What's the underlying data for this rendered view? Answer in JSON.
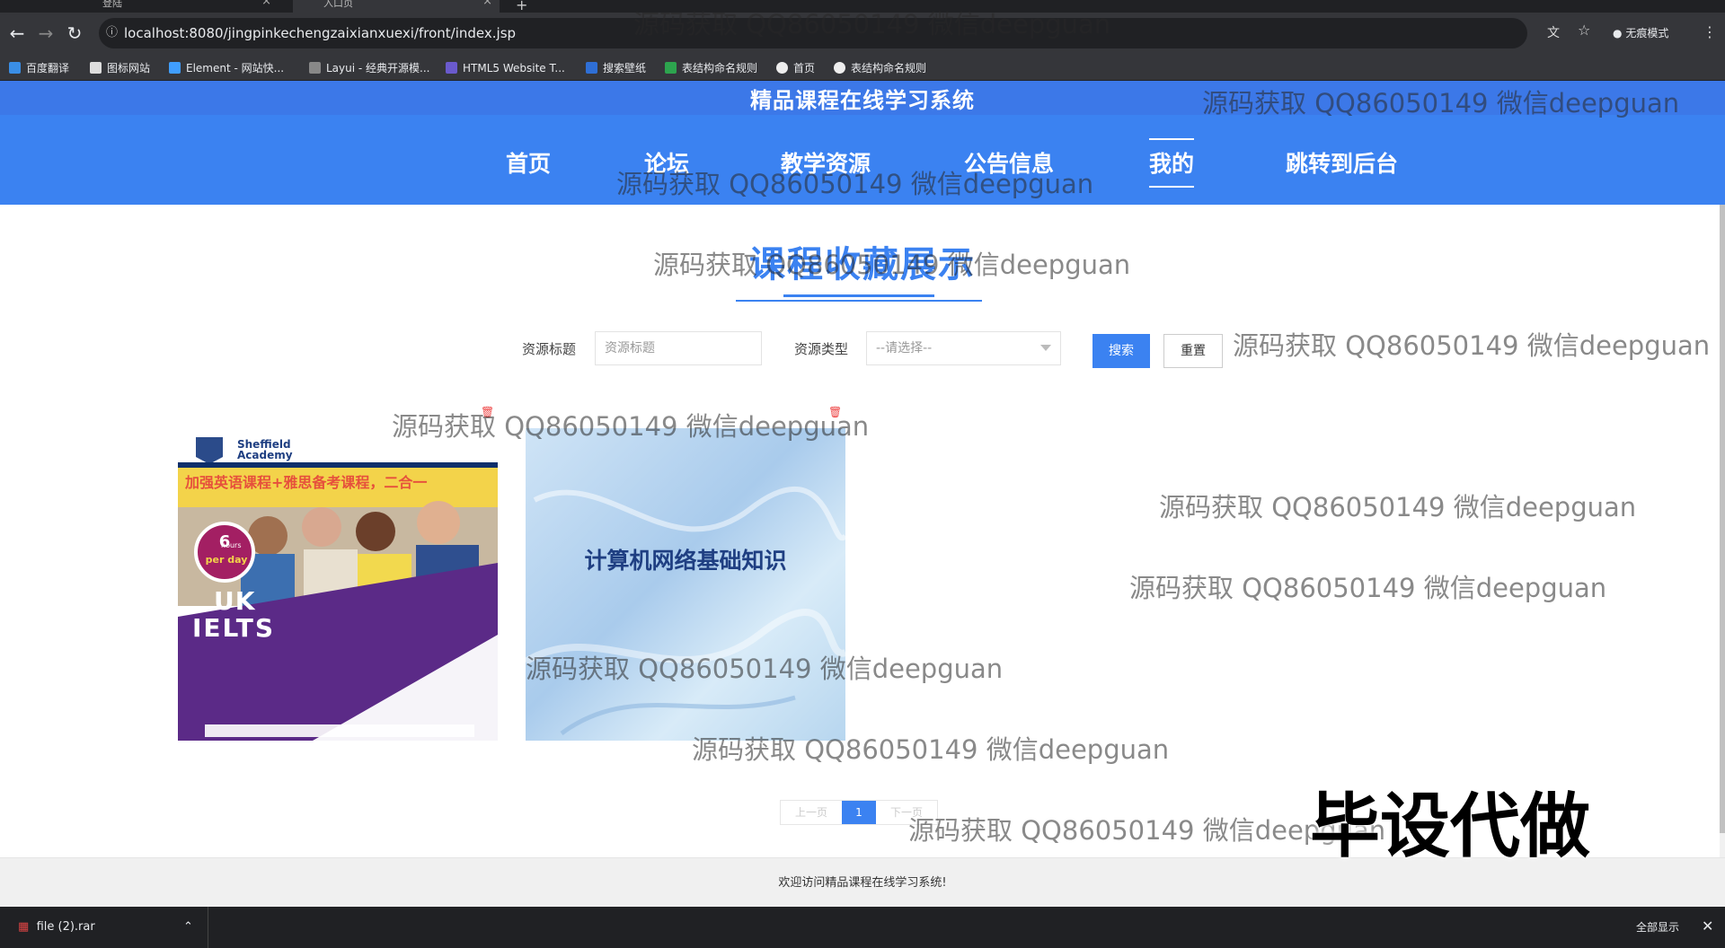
{
  "browser": {
    "tabs": [
      {
        "label": "登陆"
      },
      {
        "label": "入口页"
      }
    ],
    "url": "localhost:8080/jingpinkechengzaixianxuexi/front/index.jsp",
    "incognito_label": "无痕模式",
    "bookmarks": [
      "百度翻译",
      "图标网站",
      "Element - 网站快...",
      "Layui - 经典开源模...",
      "HTML5 Website T...",
      "搜索壁纸",
      "表结构命名规则",
      "首页",
      "表结构命名规则"
    ]
  },
  "site": {
    "title": "精品课程在线学习系统",
    "nav": [
      "首页",
      "论坛",
      "教学资源",
      "公告信息",
      "我的",
      "跳转到后台"
    ],
    "active_nav": "我的"
  },
  "page": {
    "title": "课程收藏展示",
    "search": {
      "title_label": "资源标题",
      "title_placeholder": "资源标题",
      "type_label": "资源类型",
      "type_selected": "--请选择--",
      "search_button": "搜索",
      "reset_button": "重置"
    },
    "cards": [
      {
        "delete_icon": "trash-icon",
        "poster": {
          "academy": "Sheffield Academy",
          "banner": "加强英语课程+雅思备考课程，二合一",
          "badge_big": "6",
          "badge_small1": "hours",
          "badge_small2": "per day",
          "uk": "UK",
          "ielts": "IELTS"
        }
      },
      {
        "delete_icon": "trash-icon",
        "title": "计算机网络基础知识"
      }
    ],
    "pagination": {
      "prev": "上一页",
      "current": "1",
      "next": "下一页"
    }
  },
  "footer": {
    "text": "欢迎访问精品课程在线学习系统!"
  },
  "download_bar": {
    "file": "file (2).rar",
    "show_all": "全部显示"
  },
  "watermarks": {
    "text": "源码获取 QQ86050149 微信deepguan",
    "stamp": "毕设代做"
  },
  "colors": {
    "primary": "#3b82f1",
    "header_top": "#3c78e8"
  }
}
